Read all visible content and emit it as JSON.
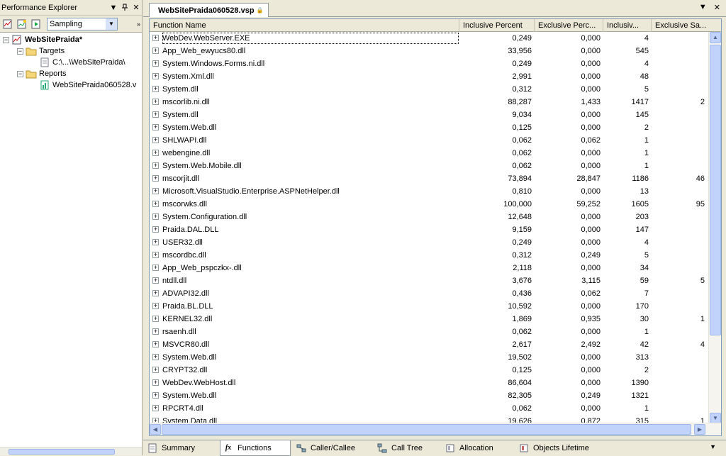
{
  "explorer": {
    "title": "Performance Explorer",
    "mode": "Sampling",
    "tree": {
      "project": "WebSitePraida*",
      "targets_label": "Targets",
      "target_item": "C:\\...\\WebSitePraida\\",
      "reports_label": "Reports",
      "report_item": "WebSitePraida060528.v"
    }
  },
  "document": {
    "tab_title": "WebSitePraida060528.vsp",
    "columns": [
      "Function Name",
      "Inclusive Percent",
      "Exclusive Perc...",
      "Inclusiv...",
      "Exclusive Sa..."
    ],
    "rows": [
      {
        "name": "WebDev.WebServer.EXE",
        "incl_pct": "0,249",
        "excl_pct": "0,000",
        "incl_s": "4",
        "excl_s": ""
      },
      {
        "name": "App_Web_ewyucs80.dll",
        "incl_pct": "33,956",
        "excl_pct": "0,000",
        "incl_s": "545",
        "excl_s": ""
      },
      {
        "name": "System.Windows.Forms.ni.dll",
        "incl_pct": "0,249",
        "excl_pct": "0,000",
        "incl_s": "4",
        "excl_s": ""
      },
      {
        "name": "System.Xml.dll",
        "incl_pct": "2,991",
        "excl_pct": "0,000",
        "incl_s": "48",
        "excl_s": ""
      },
      {
        "name": "System.dll",
        "incl_pct": "0,312",
        "excl_pct": "0,000",
        "incl_s": "5",
        "excl_s": ""
      },
      {
        "name": "mscorlib.ni.dll",
        "incl_pct": "88,287",
        "excl_pct": "1,433",
        "incl_s": "1417",
        "excl_s": "2"
      },
      {
        "name": "System.dll",
        "incl_pct": "9,034",
        "excl_pct": "0,000",
        "incl_s": "145",
        "excl_s": ""
      },
      {
        "name": "System.Web.dll",
        "incl_pct": "0,125",
        "excl_pct": "0,000",
        "incl_s": "2",
        "excl_s": ""
      },
      {
        "name": "SHLWAPI.dll",
        "incl_pct": "0,062",
        "excl_pct": "0,062",
        "incl_s": "1",
        "excl_s": ""
      },
      {
        "name": "webengine.dll",
        "incl_pct": "0,062",
        "excl_pct": "0,000",
        "incl_s": "1",
        "excl_s": ""
      },
      {
        "name": "System.Web.Mobile.dll",
        "incl_pct": "0,062",
        "excl_pct": "0,000",
        "incl_s": "1",
        "excl_s": ""
      },
      {
        "name": "mscorjit.dll",
        "incl_pct": "73,894",
        "excl_pct": "28,847",
        "incl_s": "1186",
        "excl_s": "46"
      },
      {
        "name": "Microsoft.VisualStudio.Enterprise.ASPNetHelper.dll",
        "incl_pct": "0,810",
        "excl_pct": "0,000",
        "incl_s": "13",
        "excl_s": ""
      },
      {
        "name": "mscorwks.dll",
        "incl_pct": "100,000",
        "excl_pct": "59,252",
        "incl_s": "1605",
        "excl_s": "95"
      },
      {
        "name": "System.Configuration.dll",
        "incl_pct": "12,648",
        "excl_pct": "0,000",
        "incl_s": "203",
        "excl_s": ""
      },
      {
        "name": "Praida.DAL.DLL",
        "incl_pct": "9,159",
        "excl_pct": "0,000",
        "incl_s": "147",
        "excl_s": ""
      },
      {
        "name": "USER32.dll",
        "incl_pct": "0,249",
        "excl_pct": "0,000",
        "incl_s": "4",
        "excl_s": ""
      },
      {
        "name": "mscordbc.dll",
        "incl_pct": "0,312",
        "excl_pct": "0,249",
        "incl_s": "5",
        "excl_s": ""
      },
      {
        "name": "App_Web_pspczkx-.dll",
        "incl_pct": "2,118",
        "excl_pct": "0,000",
        "incl_s": "34",
        "excl_s": ""
      },
      {
        "name": "ntdll.dll",
        "incl_pct": "3,676",
        "excl_pct": "3,115",
        "incl_s": "59",
        "excl_s": "5"
      },
      {
        "name": "ADVAPI32.dll",
        "incl_pct": "0,436",
        "excl_pct": "0,062",
        "incl_s": "7",
        "excl_s": ""
      },
      {
        "name": "Praida.BL.DLL",
        "incl_pct": "10,592",
        "excl_pct": "0,000",
        "incl_s": "170",
        "excl_s": ""
      },
      {
        "name": "KERNEL32.dll",
        "incl_pct": "1,869",
        "excl_pct": "0,935",
        "incl_s": "30",
        "excl_s": "1"
      },
      {
        "name": "rsaenh.dll",
        "incl_pct": "0,062",
        "excl_pct": "0,000",
        "incl_s": "1",
        "excl_s": ""
      },
      {
        "name": "MSVCR80.dll",
        "incl_pct": "2,617",
        "excl_pct": "2,492",
        "incl_s": "42",
        "excl_s": "4"
      },
      {
        "name": "System.Web.dll",
        "incl_pct": "19,502",
        "excl_pct": "0,000",
        "incl_s": "313",
        "excl_s": ""
      },
      {
        "name": "CRYPT32.dll",
        "incl_pct": "0,125",
        "excl_pct": "0,000",
        "incl_s": "2",
        "excl_s": ""
      },
      {
        "name": "WebDev.WebHost.dll",
        "incl_pct": "86,604",
        "excl_pct": "0,000",
        "incl_s": "1390",
        "excl_s": ""
      },
      {
        "name": "System.Web.dll",
        "incl_pct": "82,305",
        "excl_pct": "0,249",
        "incl_s": "1321",
        "excl_s": ""
      },
      {
        "name": "RPCRT4.dll",
        "incl_pct": "0,062",
        "excl_pct": "0,000",
        "incl_s": "1",
        "excl_s": ""
      },
      {
        "name": "System.Data.dll",
        "incl_pct": "19,626",
        "excl_pct": "0,872",
        "incl_s": "315",
        "excl_s": "1"
      }
    ]
  },
  "view_tabs": [
    {
      "label": "Summary",
      "icon": "summary-icon"
    },
    {
      "label": "Functions",
      "icon": "function-icon"
    },
    {
      "label": "Caller/Callee",
      "icon": "caller-callee-icon"
    },
    {
      "label": "Call Tree",
      "icon": "call-tree-icon"
    },
    {
      "label": "Allocation",
      "icon": "allocation-icon"
    },
    {
      "label": "Objects Lifetime",
      "icon": "objects-lifetime-icon"
    }
  ],
  "active_view_tab": "Functions"
}
